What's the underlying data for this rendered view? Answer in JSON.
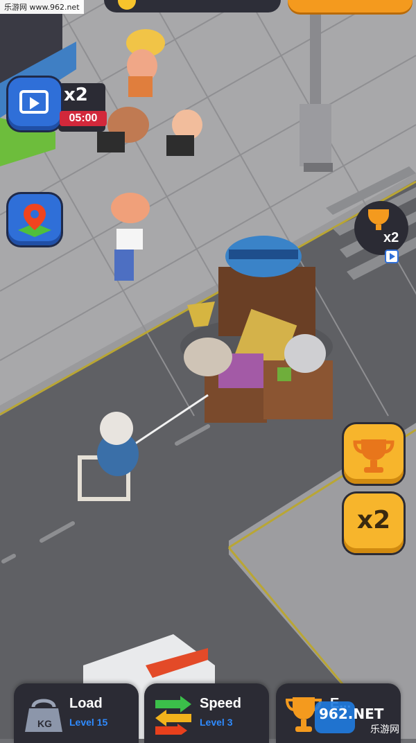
{
  "watermark_top": "乐游网 www.962.net",
  "boost_timer": {
    "multiplier": "x2",
    "time": "05:00"
  },
  "trophy_bonus": {
    "multiplier": "x2"
  },
  "side_buttons": {
    "x2_label": "x2"
  },
  "bottom_bar": {
    "load": {
      "title": "Load",
      "level": "Level 15",
      "icon_text": "KG"
    },
    "speed": {
      "title": "Speed",
      "level": "Level 3"
    },
    "earn": {
      "title": "E..."
    }
  },
  "watermark_bottom": {
    "logo": "962.NET",
    "sub": "乐游网"
  },
  "colors": {
    "accent_orange": "#f7b52c",
    "accent_blue": "#2f8bff",
    "timer_red": "#d2283b",
    "panel_dark": "#2b2b34"
  }
}
